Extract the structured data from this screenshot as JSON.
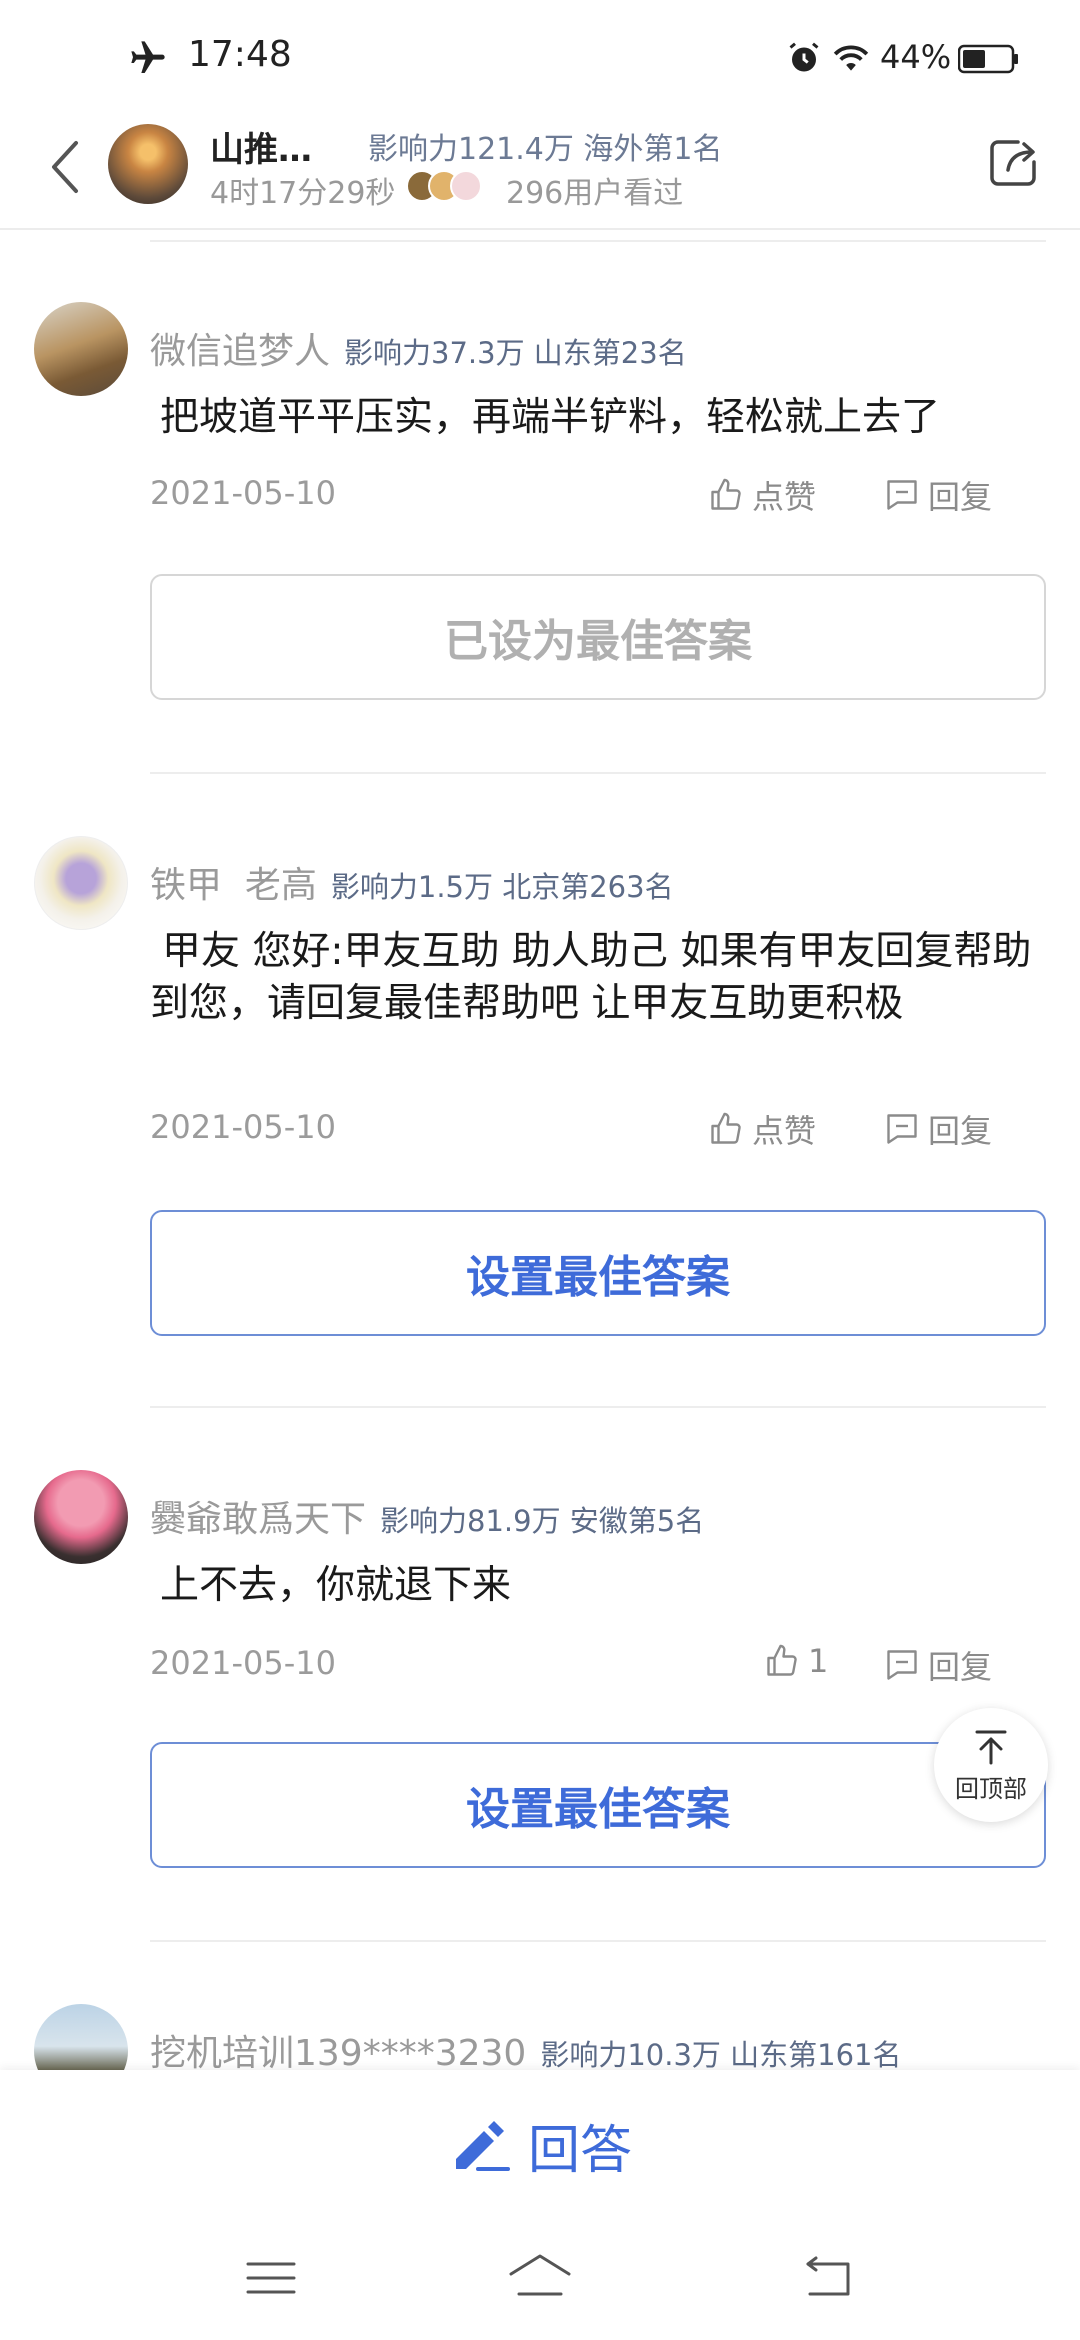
{
  "status_bar": {
    "time": "17:48",
    "battery": "44%"
  },
  "header": {
    "name": "山推…",
    "influence": "影响力121.4万 海外第1名",
    "duration": "4时17分29秒",
    "viewers": "296用户看过"
  },
  "comments": [
    {
      "author": "微信追梦人",
      "meta": "影响力37.3万 山东第23名",
      "text": "把坡道平平压实，再端半铲料，轻松就上去了",
      "date": "2021-05-10",
      "like": "点赞",
      "reply": "回复",
      "button": "已设为最佳答案"
    },
    {
      "author": "铁甲  老高",
      "meta": "影响力1.5万 北京第263名",
      "text": "甲友 您好:甲友互助 助人助己 如果有甲友回复帮助到您，请回复最佳帮助吧 让甲友互助更积极",
      "date": "2021-05-10",
      "like": "点赞",
      "reply": "回复",
      "button": "设置最佳答案"
    },
    {
      "author": "爨爺敢爲天下",
      "meta": "影响力81.9万 安徽第5名",
      "text": "上不去，你就退下来",
      "date": "2021-05-10",
      "like": "1",
      "reply": "回复",
      "button": "设置最佳答案"
    },
    {
      "author": "挖机培训139****3230",
      "meta": "影响力10.3万 山东第161名"
    }
  ],
  "back_to_top": "回顶部",
  "answer_bar": {
    "label": "回答"
  },
  "colors": {
    "accent": "#3e6bd9",
    "meta": "#5c6b87",
    "muted": "#9b9b9b"
  }
}
